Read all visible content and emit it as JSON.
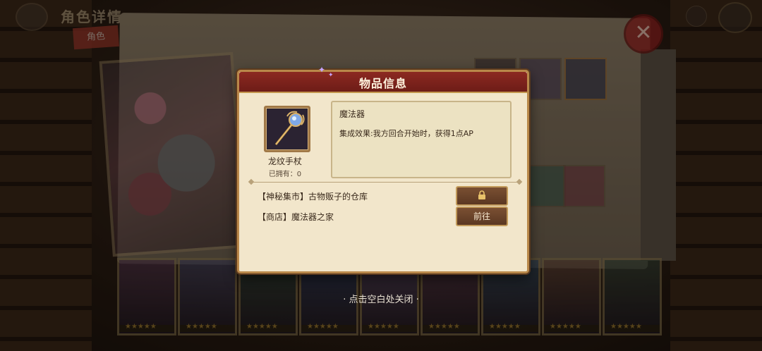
{
  "background": {
    "screen_title": "角色详情",
    "role_tag": "角色",
    "close_symbol": "✕",
    "roster_cards": 9
  },
  "dialog": {
    "title": "物品信息",
    "item": {
      "name": "龙纹手杖",
      "owned": "已拥有：0",
      "icon": "staff-icon"
    },
    "description": {
      "type": "魔法器",
      "effect": "集成效果:我方回合开始时，获得1点AP"
    },
    "sources": [
      {
        "label": "【神秘集市】古物贩子的仓库",
        "button_icon": "lock-icon",
        "button_label": ""
      },
      {
        "label": "【商店】魔法器之家",
        "button_label": "前往"
      }
    ]
  },
  "hint": "· 点击空白处关闭 ·",
  "colors": {
    "header_red": "#7d231c",
    "dialog_bg": "#f2e6cb",
    "button_brown": "#6a4429",
    "gold_border": "#b9884a"
  }
}
